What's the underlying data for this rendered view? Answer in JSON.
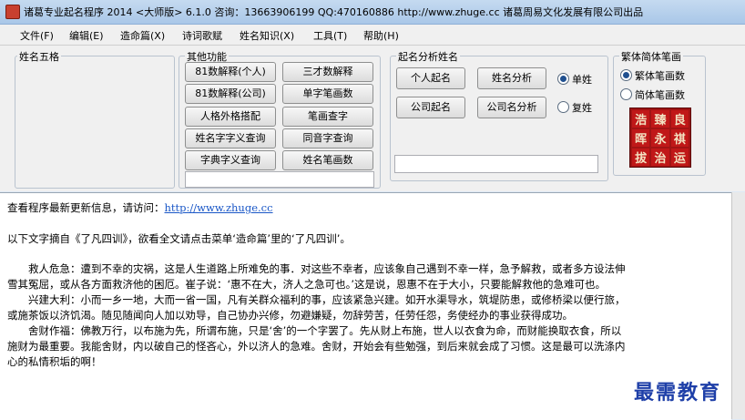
{
  "window": {
    "title": "诸葛专业起名程序  2014  <大师版> 6.1.0    咨询：13663906199 QQ:470160886  http://www.zhuge.cc    诸葛周易文化发展有限公司出品"
  },
  "menu": [
    "文件(F)",
    "编辑(E)",
    "造命篇(X)",
    "诗词歌赋",
    "姓名知识(X)",
    "工具(T)",
    "帮助(H)"
  ],
  "groups": {
    "name_grid": "姓名五格",
    "other_functions": "其他功能",
    "naming_analysis": "起名分析姓名",
    "stroke_count": "繁体简体笔画"
  },
  "other_buttons": [
    "81数解释(个人)",
    "三才数解释",
    "81数解释(公司)",
    "单字笔画数",
    "人格外格搭配",
    "笔画查字",
    "姓名字字义查询",
    "同音字查询",
    "字典字义查询",
    "姓名笔画数"
  ],
  "naming_buttons": [
    "个人起名",
    "姓名分析",
    "公司起名",
    "公司名分析"
  ],
  "name_type": {
    "single": "单姓",
    "compound": "复姓",
    "selected": "single"
  },
  "stroke_type": {
    "traditional": "繁体笔画数",
    "simplified": "简体笔画数",
    "selected": "traditional"
  },
  "brush_chars": [
    "浩",
    "臻",
    "良",
    "晖",
    "永",
    "祺",
    "拔",
    "治",
    "运"
  ],
  "content": {
    "update_prefix": "查看程序最新更新信息，请访问：",
    "update_link": "http://www.zhuge.cc",
    "excerpt": "以下文字摘自《了凡四训》，欲看全文请点击菜单‘造命篇’里的‘了凡四训’。",
    "paragraphs": [
      "　　救人危急：遭到不幸的灾祸，这是人生道路上所难免的事．对这些不幸者，应该象自己遇到不幸一样，急予解救，或者多方设法伸",
      "雪其冤屈，或从各方面救济他的困厄。崔子说：‘惠不在大，济人之急可也。’这是说，恩惠不在于大小，只要能解救他的急难可也。",
      "　　兴建大利：小而一乡一地，大而一省一国，凡有关群众福利的事，应该紧急兴建。如开水渠导水，筑堤防患，或修桥梁以便行旅，",
      "或施茶饭以济饥渴。随见随闻向人加以劝导，自己协办兴修，勿避嫌疑，勿辞劳苦，任劳任怨，务使经办的事业获得成功。",
      "　　舍财作福：佛教万行，以布施为先，所谓布施，只是‘舍’的一个字罢了。先从财上布施，世人以衣食为命，而财能换取衣食，所以",
      "施财为最重要。我能舍财，内以破自己的怪吝心，外以济人的急难。舍财，开始会有些勉强，到后来就会成了习惯。这是最可以洗涤内",
      "心的私情积垢的啊！"
    ],
    "partial": "　　　　　　　　　　　　　　　　　　　　　　　　　　　　　　　　　　　　　　　　　　　　　　　　　　　　　　　　　　　　　　　　　　　　　　　　　　　　　　　　　　　　　　　　　　　　　　　　　　　　　　　　　　　　　　　　　　　　　　　　　　　　　　　　　　　　　　　　　　　　　　　　　　"
  },
  "watermark": "最需教育"
}
